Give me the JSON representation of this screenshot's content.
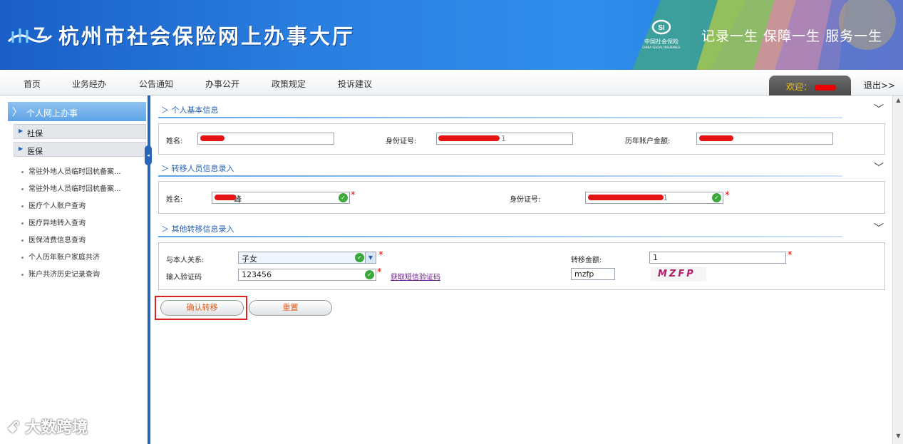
{
  "header": {
    "site_title": "杭州市社会保险网上办事大厅",
    "si_logo_cn": "中国社会保险",
    "si_logo_en": "CHINA SOCIAL INSURANCE",
    "slogan": "记录一生  保障一生  服务一生"
  },
  "nav": {
    "items": [
      "首页",
      "业务经办",
      "公告通知",
      "办事公开",
      "政策规定",
      "投诉建议"
    ],
    "welcome": "欢迎：",
    "logout": "退出>>"
  },
  "sidebar": {
    "head": "个人网上办事",
    "groups": [
      "社保",
      "医保"
    ],
    "links": [
      "常驻外地人员临时回杭备案...",
      "常驻外地人员临时回杭备案...",
      "医疗个人账户查询",
      "医疗异地转入查询",
      "医保消费信息查询",
      "个人历年账户家庭共济",
      "账户共济历史记录查询"
    ]
  },
  "sections": {
    "basic": {
      "title": "个人基本信息",
      "name_label": "姓名:",
      "id_label": "身份证号:",
      "balance_label": "历年账户金额:",
      "id_tail": "1"
    },
    "transfer": {
      "title": "转移人员信息录入",
      "name_label": "姓名:",
      "name_tail": "峰",
      "id_label": "身份证号:",
      "id_tail": "1"
    },
    "other": {
      "title": "其他转移信息录入",
      "relation_label": "与本人关系:",
      "relation_value": "子女",
      "amount_label": "转移金额:",
      "amount_value": "1",
      "captcha_label": "输入验证码",
      "captcha_value": "123456",
      "sms_link": "获取短信验证码",
      "captcha_input": "mzfp",
      "captcha_image": "MZFP"
    }
  },
  "actions": {
    "confirm": "确认转移",
    "reset": "重置"
  },
  "watermark": "大数跨境",
  "colors": {
    "banner": "#2a7fe0",
    "accent": "#2a64b8",
    "required": "#e00000",
    "highlight": "#dd2222"
  }
}
